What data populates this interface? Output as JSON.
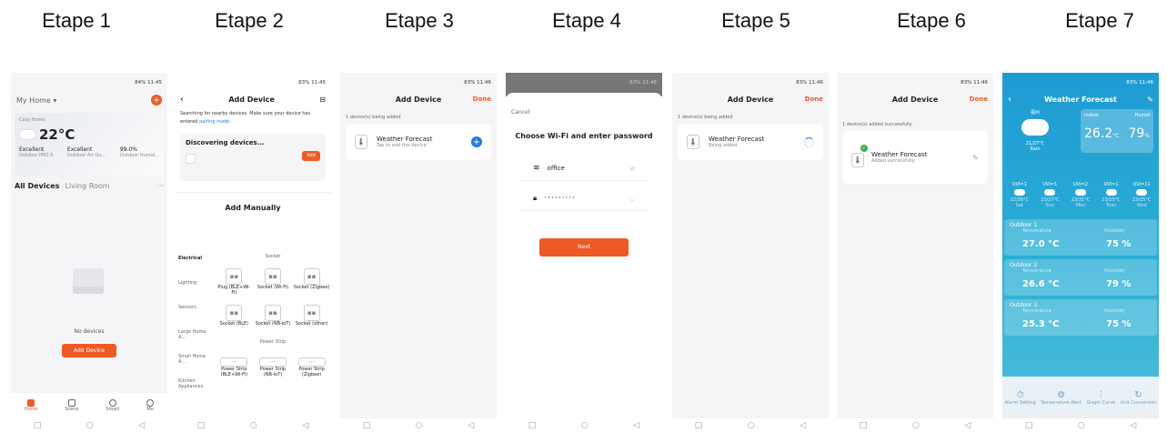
{
  "steps": [
    "Etape 1",
    "Etape 2",
    "Etape 3",
    "Etape 4",
    "Etape 5",
    "Etape 6",
    "Etape 7"
  ],
  "status": {
    "t1": "84% 11:45",
    "t2": "83% 11:45",
    "t3": "83% 11:46"
  },
  "s1": {
    "home": "My Home ▾",
    "cozy": "Cozy Home",
    "temp": "22°C",
    "stats": [
      {
        "v": "Excellent",
        "l": "Outdoor PM2.5"
      },
      {
        "v": "Excellent",
        "l": "Outdoor Air Qu..."
      },
      {
        "v": "99.0%",
        "l": "Outdoor Humid..."
      }
    ],
    "tab1": "All Devices",
    "tab2": "Living Room",
    "empty": "No devices",
    "add": "Add Device",
    "nav": [
      "Home",
      "Scene",
      "Smart",
      "Me"
    ]
  },
  "s2": {
    "title": "Add Device",
    "search": "Searching for nearby devices. Make sure your device has entered",
    "pairing": "pairing mode.",
    "disc": "Discovering devices...",
    "add": "Add",
    "manual": "Add Manually",
    "cats": [
      "Electrical",
      "Lighting",
      "Sensors",
      "Large Home A...",
      "Small Home A...",
      "Kitchen Appliances"
    ],
    "socket_hdr": "Socket",
    "sockets": [
      "Plug (BLE+Wi-Fi)",
      "Socket (Wi-Fi)",
      "Socket (Zigbee)",
      "Socket (BLE)",
      "Socket (NB-IoT)",
      "Socket (other)"
    ],
    "strip_hdr": "Power Strip",
    "strips": [
      "Power Strip (BLE+Wi-Fi)",
      "Power Strip (NB-IoT)",
      "Power Strip (Zigbee)"
    ]
  },
  "s3": {
    "title": "Add Device",
    "done": "Done",
    "count": "1 device(s) being added",
    "dev": "Weather Forecast",
    "sub": "Tap to add this device"
  },
  "s4": {
    "cancel": "Cancel",
    "title": "Choose Wi-Fi and enter password",
    "ssid": "office",
    "pwd": "·········",
    "next": "Next"
  },
  "s5": {
    "title": "Add Device",
    "done": "Done",
    "count": "1 device(s) being added",
    "dev": "Weather Forecast",
    "sub": "Being added"
  },
  "s6": {
    "title": "Add Device",
    "done": "Done",
    "count": "1 device(s) added successfully",
    "dev": "Weather Forecast",
    "sub": "Added successfully"
  },
  "s7": {
    "title": "Weather Forecast",
    "city": "福州",
    "range": "21/27°C",
    "cond": "Rain",
    "indoor": "Indoor",
    "hum_l": "Humid",
    "t_in": "26.2",
    "t_unit": "°C",
    "h_in": "79",
    "h_unit": "%",
    "uv": [
      "UVI=1",
      "UVI=1",
      "UVI=2",
      "UVI=1",
      "UVI=11"
    ],
    "fr": [
      "22/26°C",
      "23/27°C",
      "23/31°C",
      "23/25°C",
      "23/25°C"
    ],
    "days": [
      "Sat",
      "Sun",
      "Mon",
      "Tues",
      "Wed"
    ],
    "outdoor": [
      {
        "n": "Outdoor 1",
        "t": "27.0 °C",
        "h": "75 %"
      },
      {
        "n": "Outdoor 2",
        "t": "26.6 °C",
        "h": "79 %"
      },
      {
        "n": "Outdoor 3",
        "t": "25.3 °C",
        "h": "75 %"
      }
    ],
    "tl": "Temperature",
    "hl": "Humidity",
    "foot": [
      "Alarm Setting",
      "Temperature Alert",
      "Graph Curve",
      "Unit Conversion"
    ]
  },
  "colors": {
    "accent": "#ee5a24",
    "blue": "#1f7bd6",
    "sky": "#3ea6d6"
  }
}
